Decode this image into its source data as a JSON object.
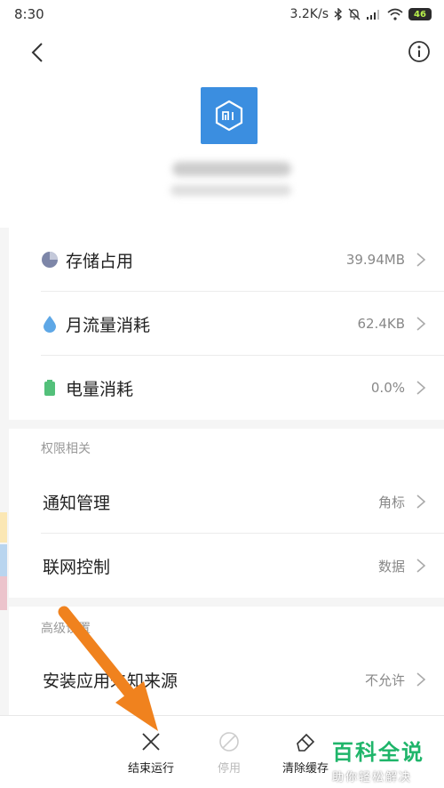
{
  "status": {
    "time": "8:30",
    "speed": "3.2K/s",
    "battery": "46"
  },
  "usage": [
    {
      "label": "存储占用",
      "value": "39.94MB",
      "icon": "pie-chart-icon",
      "color": "#7d86a8"
    },
    {
      "label": "月流量消耗",
      "value": "62.4KB",
      "icon": "water-drop-icon",
      "color": "#5ea7e6"
    },
    {
      "label": "电量消耗",
      "value": "0.0%",
      "icon": "battery-icon",
      "color": "#53c07a"
    }
  ],
  "permissions": {
    "title": "权限相关",
    "items": [
      {
        "label": "通知管理",
        "value": "角标"
      },
      {
        "label": "联网控制",
        "value": "数据"
      }
    ]
  },
  "advanced": {
    "title": "高级设置",
    "items": [
      {
        "label": "安装应用未知来源",
        "value": "不允许"
      }
    ]
  },
  "bottom_actions": [
    {
      "label": "结束运行",
      "icon": "close-icon",
      "enabled": true
    },
    {
      "label": "停用",
      "icon": "disable-icon",
      "enabled": false
    },
    {
      "label": "清除缓存",
      "icon": "eraser-icon",
      "enabled": true
    }
  ],
  "watermark": {
    "main": "百科全说",
    "sub": "助你轻松解决"
  },
  "colors": {
    "app_icon": "#3b8ee0",
    "arrow": "#f0821e",
    "watermark": "#1fb56a"
  }
}
